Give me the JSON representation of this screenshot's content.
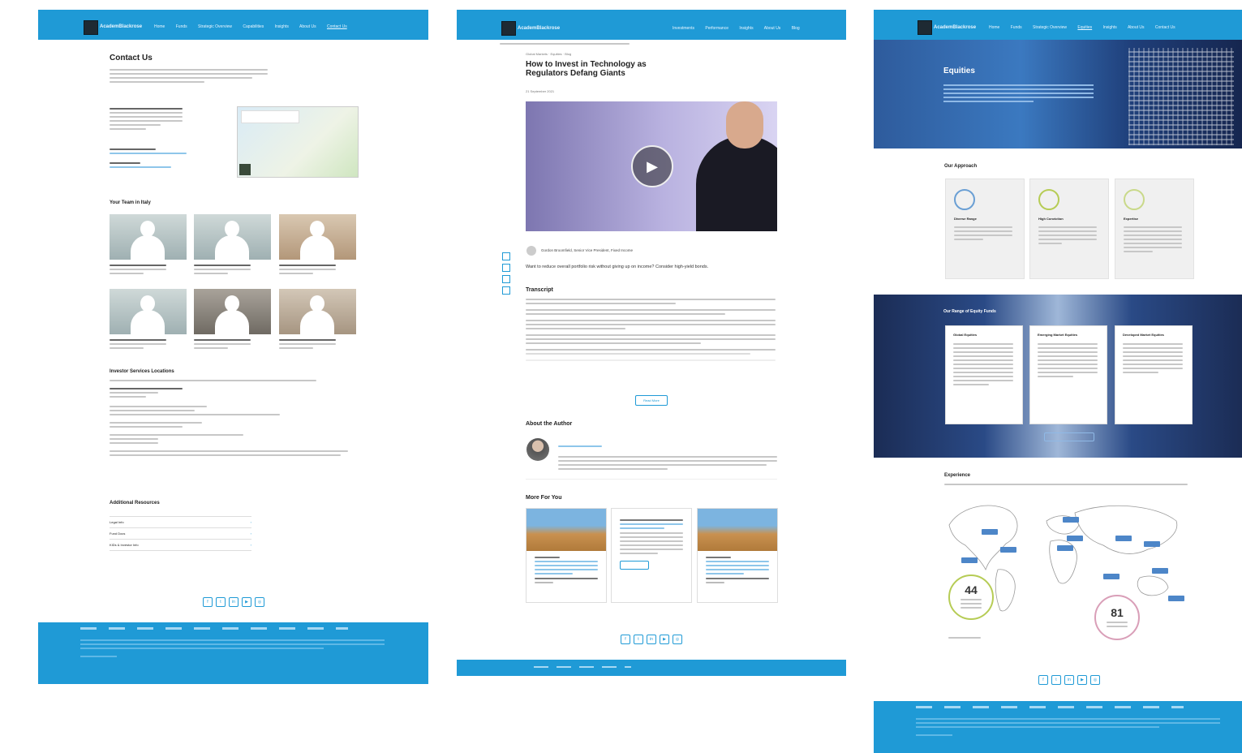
{
  "panel1": {
    "brand": "AcademBlackrose",
    "nav": [
      "Home",
      "Funds",
      "Strategic Overview",
      "Capabilities",
      "Insights",
      "About Us",
      "Contact Us"
    ],
    "page_title": "Contact Us",
    "team_heading": "Your Team in Italy",
    "investor_heading": "Investor Services Locations",
    "resources_heading": "Additional Resources",
    "resources": [
      "Legal Info",
      "Fund Docs",
      "KIDs & Investor Info"
    ]
  },
  "panel2": {
    "brand": "AcademBlackrose",
    "nav": [
      "Investments",
      "Performance",
      "Insights",
      "About Us",
      "Blog"
    ],
    "kicker": "Global Markets · Equities · Blog",
    "title_line1": "How to Invest in Technology as",
    "title_line2": "Regulators Defang Giants",
    "date": "21 September 2021",
    "author_line": "Gordon Broomfield, Senior Vice President, Fixed Income",
    "lede": "Want to reduce overall portfolio risk without giving up on income? Consider high-yield bonds.",
    "transcript_heading": "Transcript",
    "about_heading": "About the Author",
    "more_heading": "More For You",
    "read_more": "Read More"
  },
  "panel3": {
    "brand": "AcademBlackrose",
    "nav": [
      "Home",
      "Funds",
      "Strategic Overview",
      "Equities",
      "Insights",
      "About Us",
      "Contact Us"
    ],
    "hero_title": "Equities",
    "approach_heading": "Our Approach",
    "approach_cards": [
      "Diverse Range",
      "High Conviction",
      "Expertise"
    ],
    "range_heading": "Our Range of Equity Funds",
    "range_cards": [
      "Global Equities",
      "Emerging Market Equities",
      "Developed Market Equities"
    ],
    "experience_heading": "Experience",
    "stat1_value": "44",
    "stat2_value": "81"
  },
  "colors": {
    "brand_blue": "#1f9ad6",
    "dark": "#1e2a33"
  }
}
